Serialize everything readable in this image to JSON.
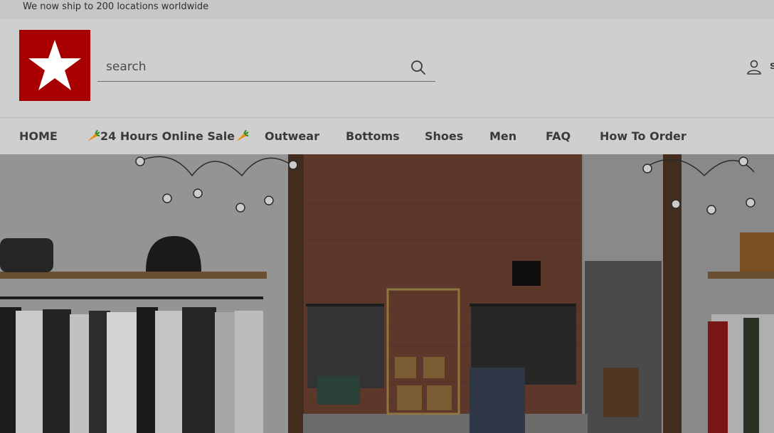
{
  "announcement": "We now ship to 200 locations worldwide",
  "brand": {
    "logo_color": "#a80000"
  },
  "search": {
    "placeholder": "search",
    "icon": "search-icon"
  },
  "account": {
    "icon": "user-icon",
    "label": "s"
  },
  "nav": {
    "items": [
      {
        "label": "HOME"
      },
      {
        "label": "24 Hours Online Sale",
        "icon": "carrot-icon"
      },
      {
        "label": "Outwear"
      },
      {
        "label": "Bottoms"
      },
      {
        "label": "Shoes"
      },
      {
        "label": "Men"
      },
      {
        "label": "FAQ"
      },
      {
        "label": "How To Order"
      }
    ]
  },
  "hero": {
    "scene": "clothing boutique interior"
  }
}
